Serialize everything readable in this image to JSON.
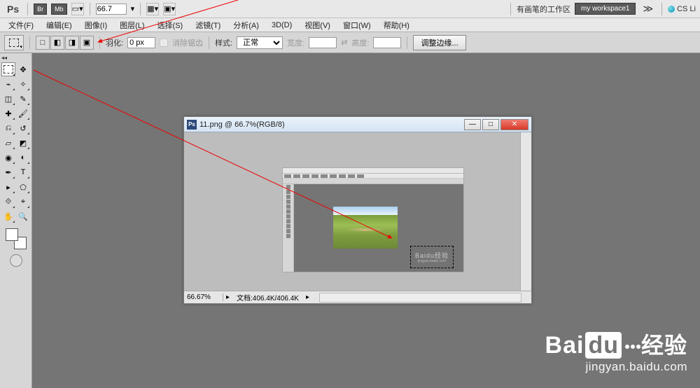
{
  "topbar": {
    "ps": "Ps",
    "br": "Br",
    "mb": "Mb",
    "zoom": "66.7",
    "dropdown_arrow": "▾"
  },
  "topright": {
    "workspace_brush": "有画笔的工作区",
    "my_workspace": "my workspace1",
    "dbl_arrow": "≫",
    "cs_live": "CS Li"
  },
  "menu": {
    "file": "文件(F)",
    "edit": "编辑(E)",
    "image": "图像(I)",
    "layer": "图层(L)",
    "select": "选择(S)",
    "filter": "滤镜(T)",
    "analysis": "分析(A)",
    "three_d": "3D(D)",
    "view": "视图(V)",
    "window": "窗口(W)",
    "help": "帮助(H)"
  },
  "options": {
    "feather_label": "羽化:",
    "feather_value": "0 px",
    "antialias": "消除锯齿",
    "style_label": "样式:",
    "style_value": "正常",
    "width_label": "宽度:",
    "height_label": "高度:",
    "refine_edge": "调整边缘..."
  },
  "doc": {
    "title": "11.png @ 66.7%(RGB/8)",
    "zoom": "66.67%",
    "doc_info": "文档:406.4K/406.4K"
  },
  "inner_marquee": {
    "wm": "Baidu经验",
    "wm_sub": "jingyan.baidu.com"
  },
  "watermark": {
    "bai": "Bai",
    "du": "du",
    "jy": "经验",
    "url": "jingyan.baidu.com"
  }
}
